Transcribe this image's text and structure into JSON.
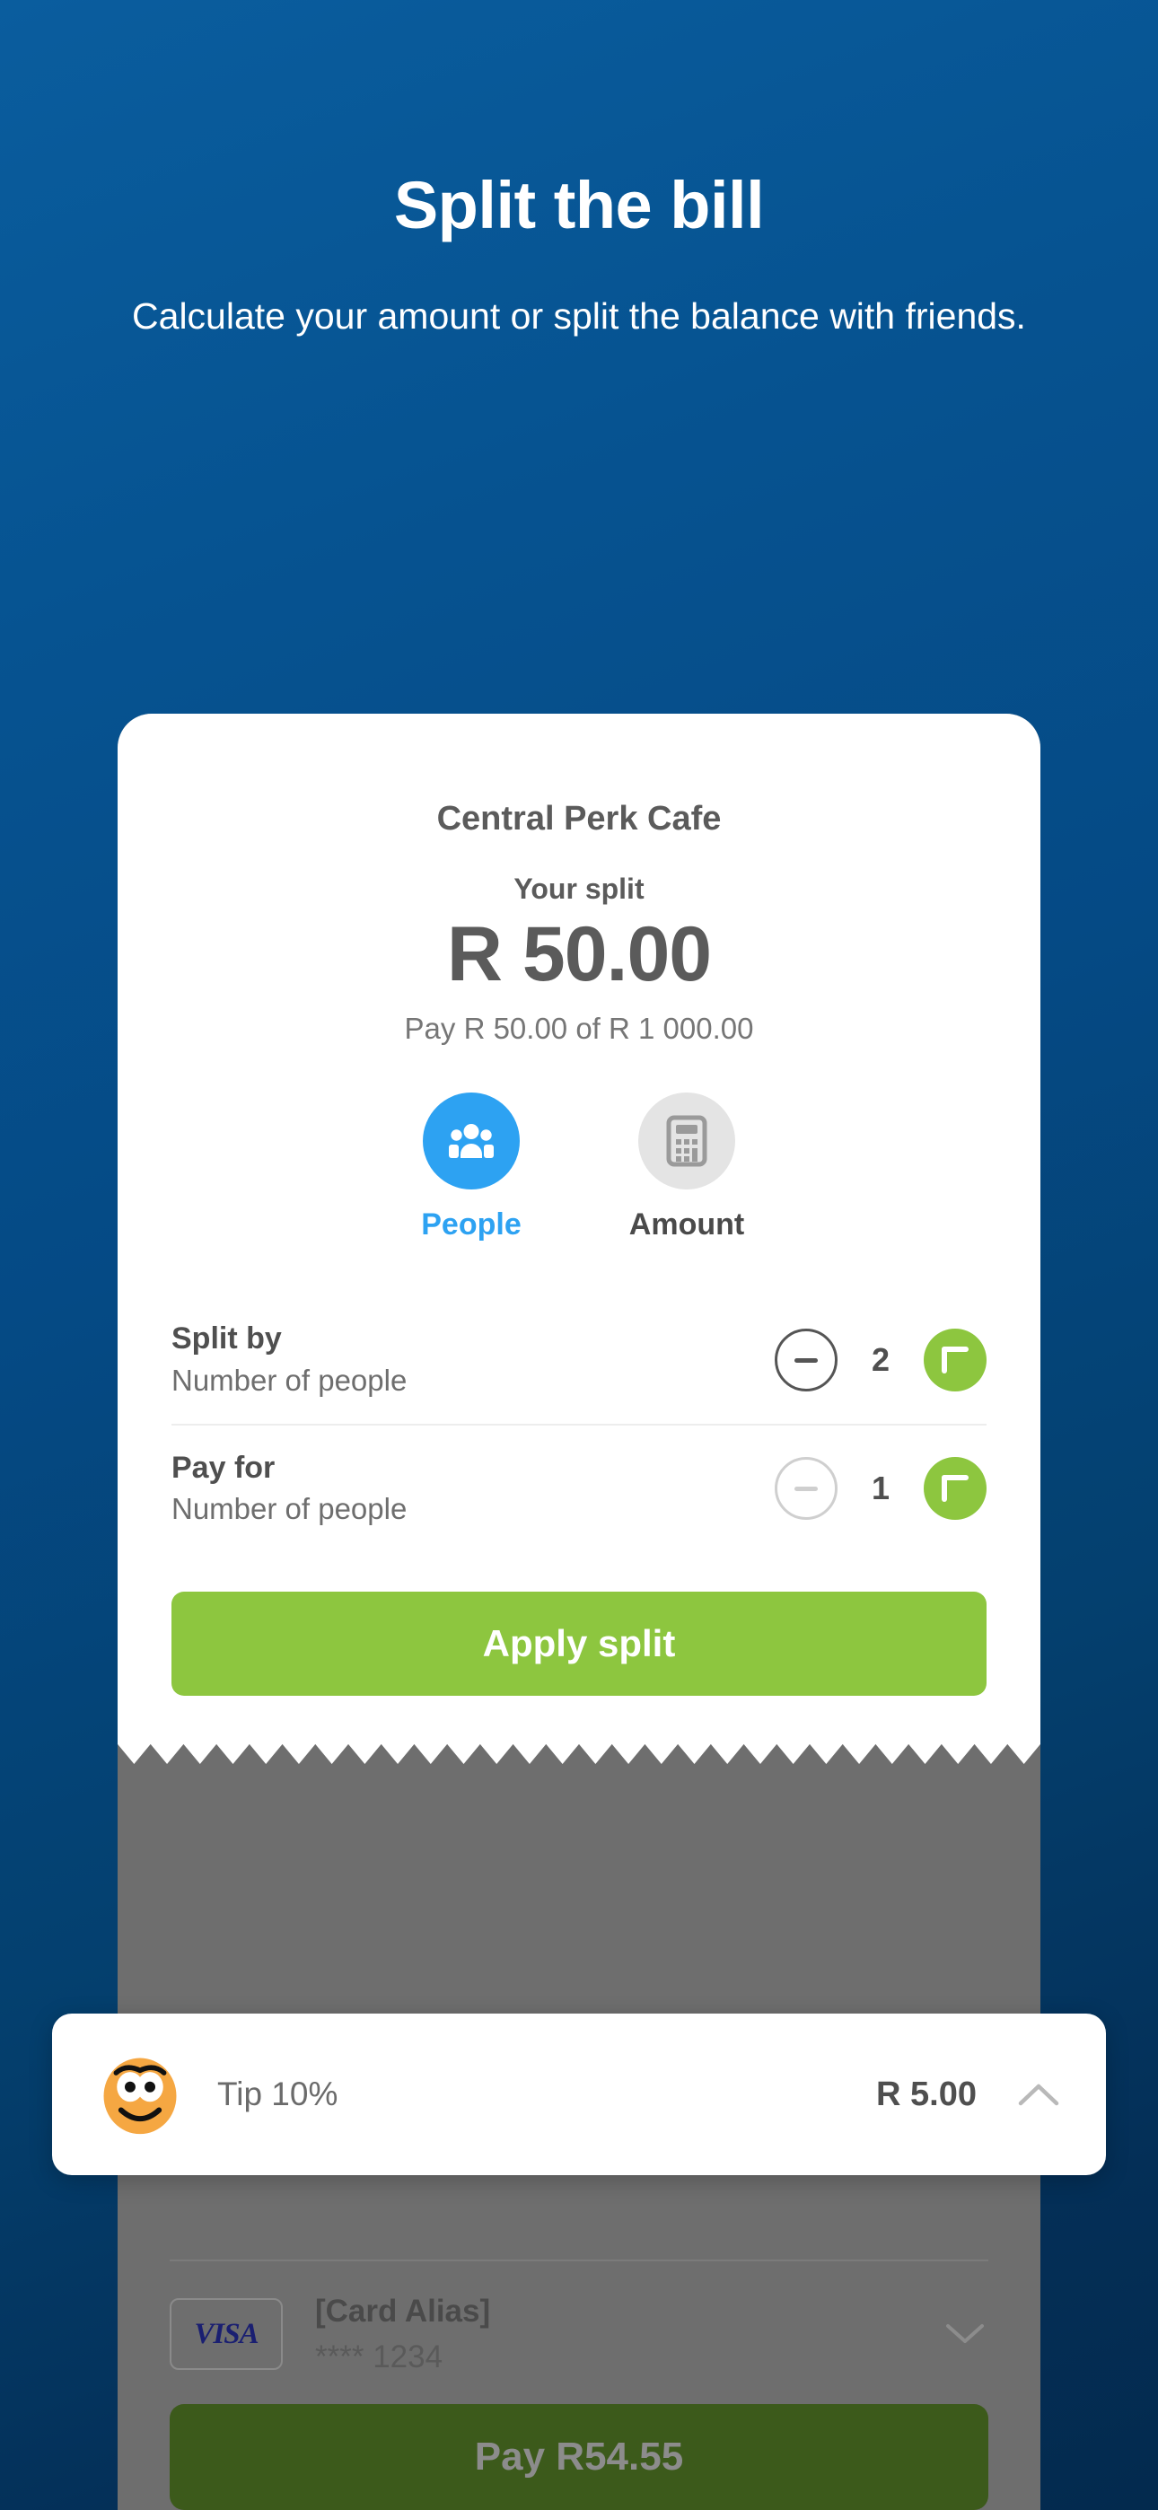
{
  "hero": {
    "title": "Split the bill",
    "subtitle": "Calculate your amount or split the balance with friends."
  },
  "receipt": {
    "merchant": "Central Perk Cafe",
    "your_split_label": "Your split",
    "split_amount": "R 50.00",
    "pay_of_text": "Pay R 50.00 of R 1 000.00",
    "modes": [
      {
        "label": "People",
        "icon": "people-group-icon",
        "active": true
      },
      {
        "label": "Amount",
        "icon": "calculator-icon",
        "active": false
      }
    ],
    "steppers": [
      {
        "title": "Split by",
        "subtitle": "Number of people",
        "value": "2",
        "minus_enabled": true,
        "plus_enabled": true
      },
      {
        "title": "Pay for",
        "subtitle": "Number of people",
        "value": "1",
        "minus_enabled": false,
        "plus_enabled": true
      }
    ],
    "apply_label": "Apply split"
  },
  "tip_bar": {
    "icon": "smiley-face-emoji",
    "label": "Tip 10%",
    "amount": "R 5.00",
    "chevron": "chevron-up-icon"
  },
  "payment": {
    "card_alias": "[Card Alias]",
    "card_number": "**** 1234",
    "card_brand": "VISA",
    "chevron": "chevron-down-icon",
    "pay_button_label": "Pay R54.55"
  },
  "colors": {
    "background_top": "#0a5d9e",
    "background_bottom": "#032a4e",
    "accent_blue": "#2da2f2",
    "accent_green": "#8dc63f",
    "dim_overlay": "#6e6e6e",
    "text_gray": "#5b5b5b",
    "emoji_orange": "#f5a742"
  }
}
